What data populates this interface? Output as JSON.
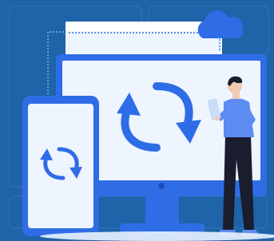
{
  "illustration": {
    "subject": "cloud-sync-illustration",
    "colors": {
      "background": "#1f63a9",
      "background_panel": "#2a6fb7",
      "device_blue": "#2f6de6",
      "screen_light": "#eef5ff",
      "arrow_blue": "#2f6de6",
      "person_shirt": "#5b8cf2",
      "person_pants": "#1a1d2e",
      "skin": "#f2c9b1",
      "hair": "#1a1d2e",
      "cloud": "#2f6de6"
    },
    "icons": [
      "cloud-icon",
      "sync-arrows-icon",
      "refresh-icon"
    ]
  }
}
